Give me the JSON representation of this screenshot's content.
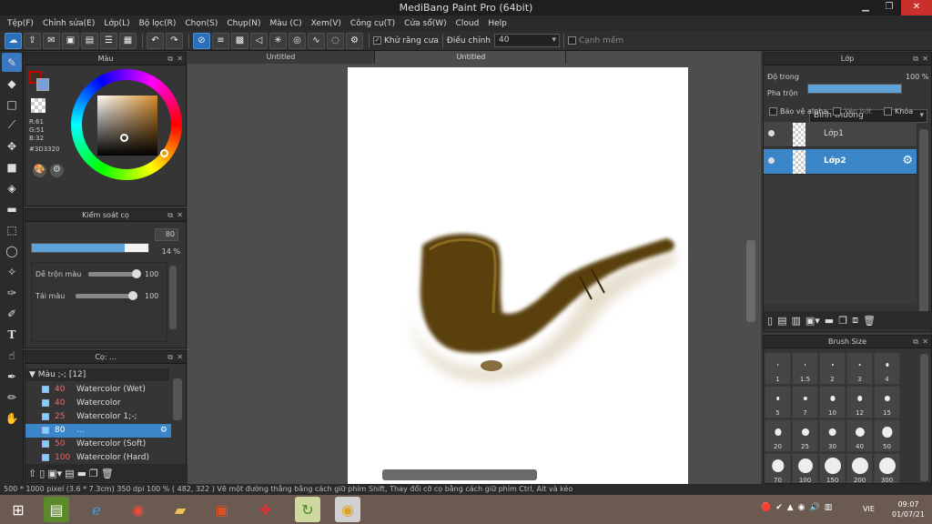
{
  "window": {
    "title": "MediBang Paint Pro (64bit)"
  },
  "menu": [
    "Tệp(F)",
    "Chỉnh sửa(E)",
    "Lớp(L)",
    "Bộ lọc(R)",
    "Chọn(S)",
    "Chụp(N)",
    "Màu (C)",
    "Xem(V)",
    "Công cụ(T)",
    "Cửa sổ(W)",
    "Cloud",
    "Help"
  ],
  "toolbar": {
    "antialias_label": "Khử răng cưa",
    "adjust_label": "Điều chỉnh",
    "adjust_value": "40",
    "edge_label": "Cạnh mềm"
  },
  "color_panel": {
    "title": "Màu",
    "r": "R:61",
    "g": "G:51",
    "b": "B:32",
    "hex": "#3D3320",
    "color": "#3D3320"
  },
  "brush_control": {
    "title": "Kiểm soát cọ",
    "size_value": "80",
    "opacity_value": "14 %",
    "blend_label": "Dễ trộn màu",
    "blend_value": "100",
    "amount_label": "Tải màu",
    "amount_value": "100",
    "size_fraction": 0.8,
    "opacity_fraction": 0.14
  },
  "brush_panel": {
    "title": "Cọ: ...",
    "group": "Màu ;-; [12]",
    "items": [
      {
        "num": "40",
        "name": "Watercolor (Wet)"
      },
      {
        "num": "40",
        "name": "Watercolor"
      },
      {
        "num": "25",
        "name": "Watercolor 1;-;"
      },
      {
        "num": "80",
        "name": "..."
      },
      {
        "num": "50",
        "name": "Watercolor (Soft)"
      },
      {
        "num": "100",
        "name": "Watercolor (Hard)"
      }
    ]
  },
  "tabs": [
    "Untitled",
    "Untitled"
  ],
  "layer_panel": {
    "title": "Lớp",
    "opacity_label": "Độ trong",
    "opacity_value": "100 %",
    "blend_label": "Pha trộn",
    "blend_value": "Bình thường",
    "protect_alpha": "Bảo vệ alpha",
    "clip": "Xén bớt",
    "lock": "Khóa",
    "layers": [
      "Lớp1",
      "Lớp2"
    ]
  },
  "brush_size": {
    "title": "Brush Size",
    "sizes": [
      "1",
      "1.5",
      "2",
      "3",
      "4",
      "5",
      "7",
      "10",
      "12",
      "15",
      "20",
      "25",
      "30",
      "40",
      "50",
      "70",
      "100",
      "150",
      "200",
      "300"
    ]
  },
  "status": {
    "text": "500 * 1000 pixel   (3.6 * 7.3cm)   350 dpi   100 %   ( 482, 322 )   Vẽ một đường thẳng bằng cách giữ phím Shift, Thay đổi cỡ cọ bằng cách giữ phím Ctrl, Alt và kéo"
  },
  "taskbar": {
    "lang": "VIE",
    "time": "09:07",
    "date": "01/07/21"
  }
}
